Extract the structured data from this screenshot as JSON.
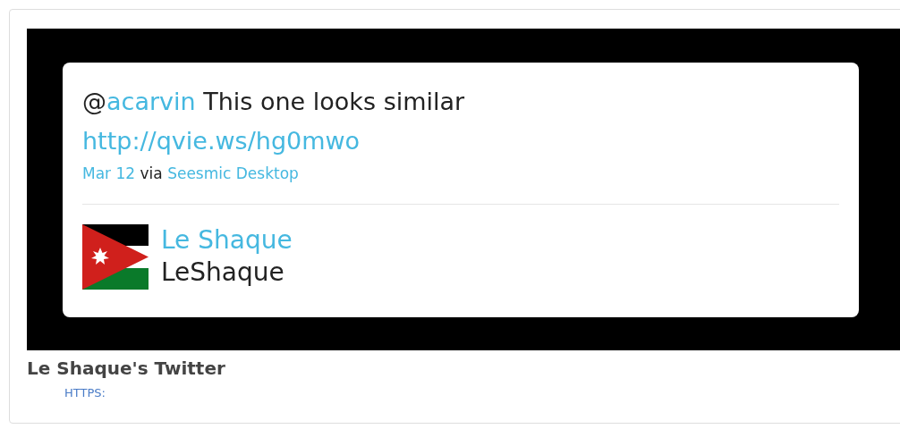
{
  "tweet": {
    "prefix": "@",
    "mention": "acarvin",
    "text": " This one looks similar",
    "url": "http://qvie.ws/hg0mwo"
  },
  "meta": {
    "date": "Mar 12",
    "via": "via",
    "source": "Seesmic Desktop"
  },
  "user": {
    "name": "Le Shaque",
    "handle": "LeShaque"
  },
  "caption": "Le Shaque's Twitter",
  "link": "HTTPS:"
}
